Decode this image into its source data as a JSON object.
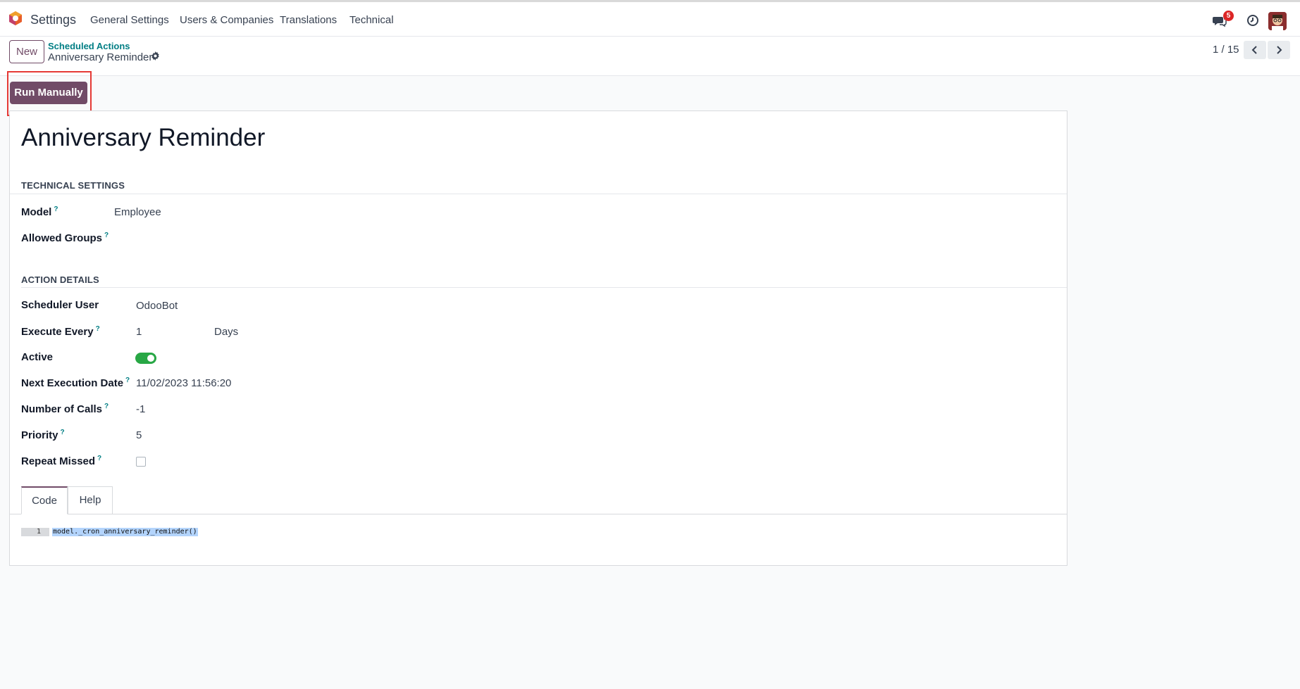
{
  "topbar": {
    "app_name": "Settings",
    "nav": [
      "General Settings",
      "Users & Companies",
      "Translations",
      "Technical"
    ],
    "messages_badge": "5",
    "icons": [
      "chat-icon",
      "clock-icon"
    ]
  },
  "control_panel": {
    "new_label": "New",
    "breadcrumb_parent": "Scheduled Actions",
    "breadcrumb_current": "Anniversary Reminder",
    "pager": "1 / 15"
  },
  "actions": {
    "run_manually": "Run Manually"
  },
  "record": {
    "title": "Anniversary Reminder",
    "technical_settings": {
      "heading": "TECHNICAL SETTINGS",
      "model_label": "Model",
      "model_value": "Employee",
      "groups_label": "Allowed Groups"
    },
    "action_details": {
      "heading": "ACTION DETAILS",
      "scheduler_user_label": "Scheduler User",
      "scheduler_user_value": "OdooBot",
      "execute_every_label": "Execute Every",
      "execute_every_value": "1",
      "execute_every_unit": "Days",
      "active_label": "Active",
      "active_value": true,
      "next_exec_label": "Next Execution Date",
      "next_exec_value": "11/02/2023 11:56:20",
      "num_calls_label": "Number of Calls",
      "num_calls_value": "-1",
      "priority_label": "Priority",
      "priority_value": "5",
      "repeat_missed_label": "Repeat Missed",
      "repeat_missed_value": false
    },
    "tabs": [
      "Code",
      "Help"
    ],
    "code": {
      "line_number": "1",
      "line": "model._cron_anniversary_reminder()"
    }
  },
  "colors": {
    "brand": "#714b67",
    "link": "#017e84",
    "highlight": "#e53935",
    "toggle_on": "#28a745"
  }
}
